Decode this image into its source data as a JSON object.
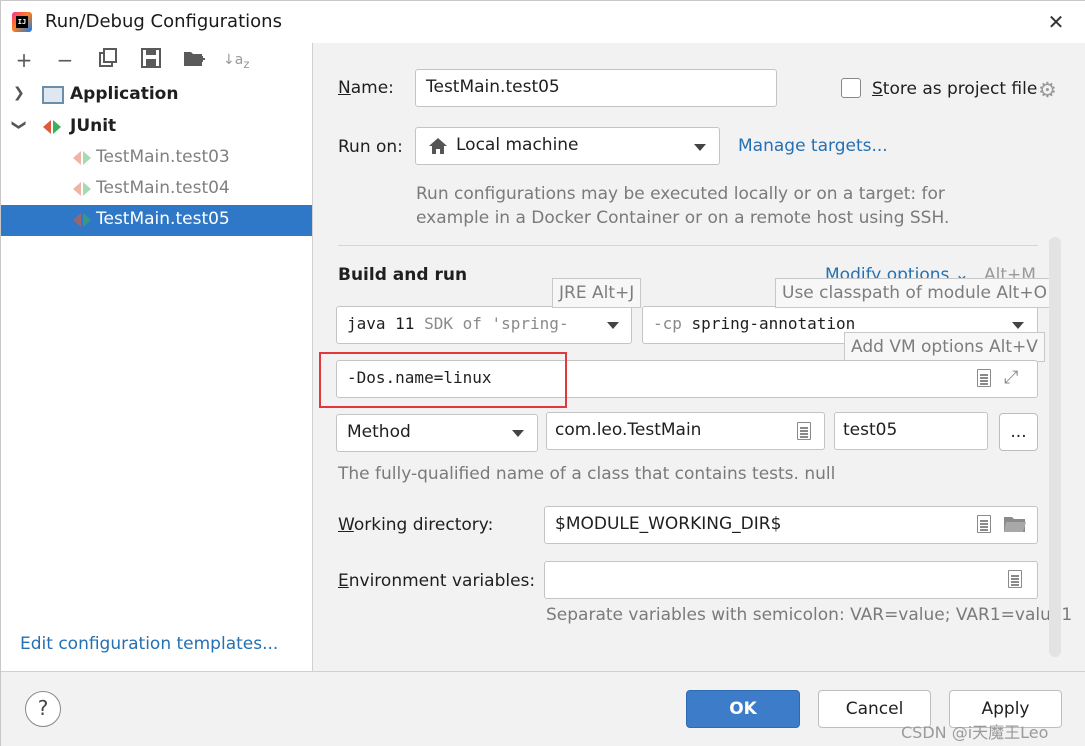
{
  "window": {
    "title": "Run/Debug Configurations"
  },
  "tree": {
    "application_label": "Application",
    "junit_label": "JUnit",
    "items": [
      {
        "label": "TestMain.test03",
        "selected": false
      },
      {
        "label": "TestMain.test04",
        "selected": false
      },
      {
        "label": "TestMain.test05",
        "selected": true
      }
    ],
    "edit_templates_link": "Edit configuration templates..."
  },
  "form": {
    "name_label": "Name:",
    "name_value": "TestMain.test05",
    "store_label": "Store as project file",
    "store_checked": false,
    "run_on_label": "Run on:",
    "run_on_value": "Local machine",
    "manage_targets": "Manage targets...",
    "run_on_hint_1": "Run configurations may be executed locally or on a target: for",
    "run_on_hint_2": "example in a Docker Container or on a remote host using SSH.",
    "build_and_run": "Build and run",
    "modify_options": "Modify options",
    "modify_shortcut": "Alt+M",
    "jre_tooltip": "JRE Alt+J",
    "classpath_tooltip": "Use classpath of module Alt+O",
    "vm_tooltip": "Add VM options Alt+V",
    "jre_value_main": "java 11",
    "jre_value_sub": "SDK of 'spring-",
    "cp_prefix": "-cp",
    "cp_value": "spring-annotation",
    "vm_options_value": "-Dos.name=linux",
    "test_kind_value": "Method",
    "class_value": "com.leo.TestMain",
    "method_value": "test05",
    "browse_label": "...",
    "class_hint": "The fully-qualified name of a class that contains tests. null",
    "working_dir_label": "Working directory:",
    "working_dir_value": "$MODULE_WORKING_DIR$",
    "env_label": "Environment variables:",
    "env_value": "",
    "env_hint": "Separate variables with semicolon: VAR=value; VAR1=value1"
  },
  "buttons": {
    "help": "?",
    "ok": "OK",
    "cancel": "Cancel",
    "apply": "Apply"
  },
  "watermark": "CSDN @i天魔王Leo",
  "colors": {
    "selection": "#2f78c8",
    "link": "#2470b3",
    "primary_button": "#3d7cc9",
    "highlight_box": "#e0383b"
  }
}
